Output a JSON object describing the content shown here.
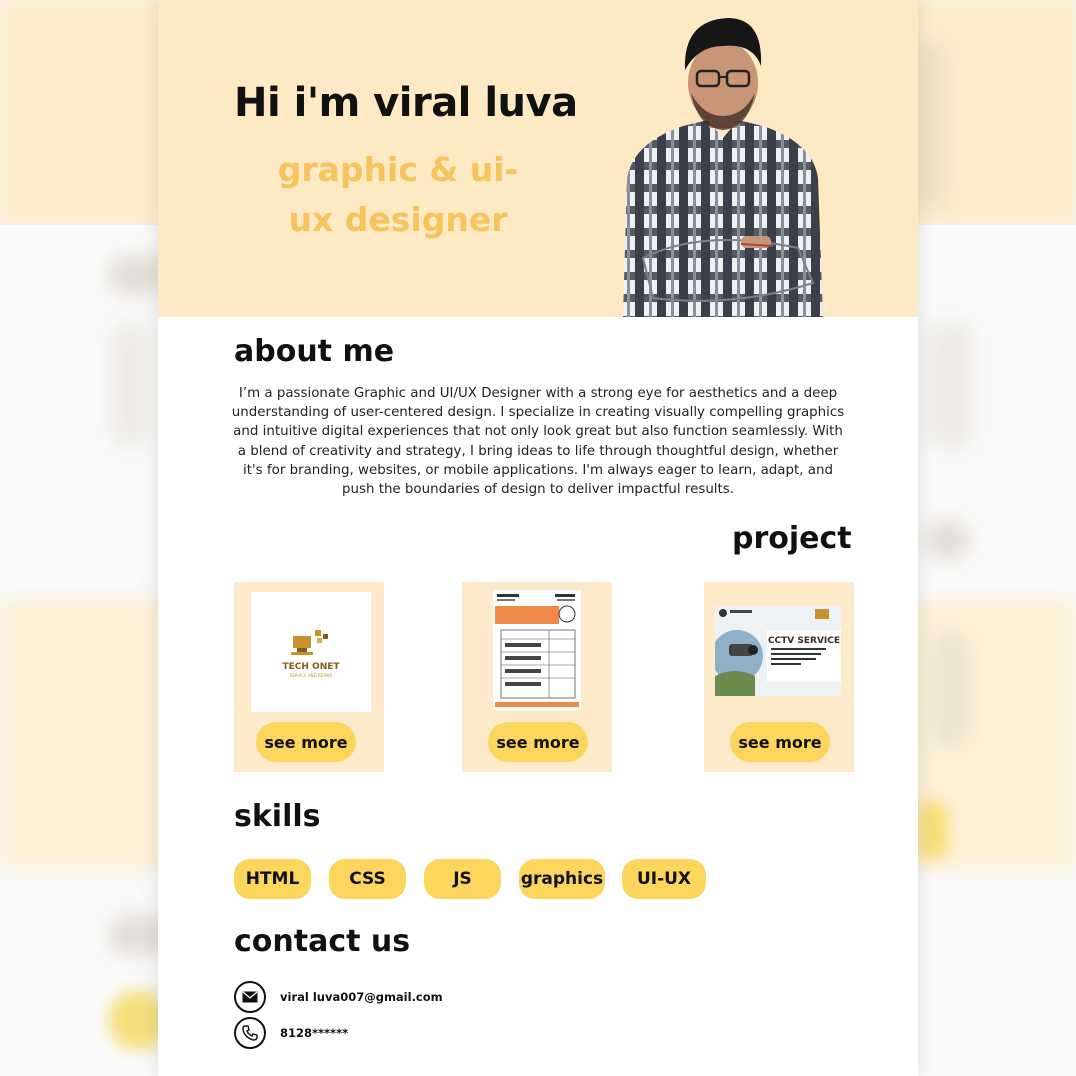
{
  "hero": {
    "title": "Hi i'm viral luva",
    "subtitle": "graphic & ui-ux designer"
  },
  "about": {
    "heading": "about me",
    "text": "I’m a passionate Graphic and UI/UX Designer with a strong eye for aesthetics and a deep understanding of user-centered design. I specialize in creating visually compelling graphics and intuitive digital experiences that not only look great but also function seamlessly. With a blend of creativity and strategy, I bring ideas to life through thoughtful design, whether it's for branding, websites, or mobile applications. I'm always eager to learn, adapt, and push the boundaries of design to deliver impactful results."
  },
  "projects": {
    "heading": "project",
    "items": [
      {
        "logo_title": "TECH ONET",
        "logo_tag": "SERVICE AND REPAIR",
        "button": "see more"
      },
      {
        "button": "see more"
      },
      {
        "banner_title": "CCTV SERVICE",
        "button": "see more"
      }
    ]
  },
  "skills": {
    "heading": "skills",
    "items": [
      "HTML",
      "CSS",
      "JS",
      "graphics",
      "UI-UX"
    ]
  },
  "contact": {
    "heading": "contact us",
    "email": "viral luva007@gmail.com",
    "phone": "8128******",
    "icons": [
      "mail-icon",
      "phone-icon"
    ]
  },
  "colors": {
    "hero_bg": "#fde9c4",
    "accent_text": "#f7c35c",
    "button": "#fcd65c",
    "card_bg": "#fdeacb"
  }
}
